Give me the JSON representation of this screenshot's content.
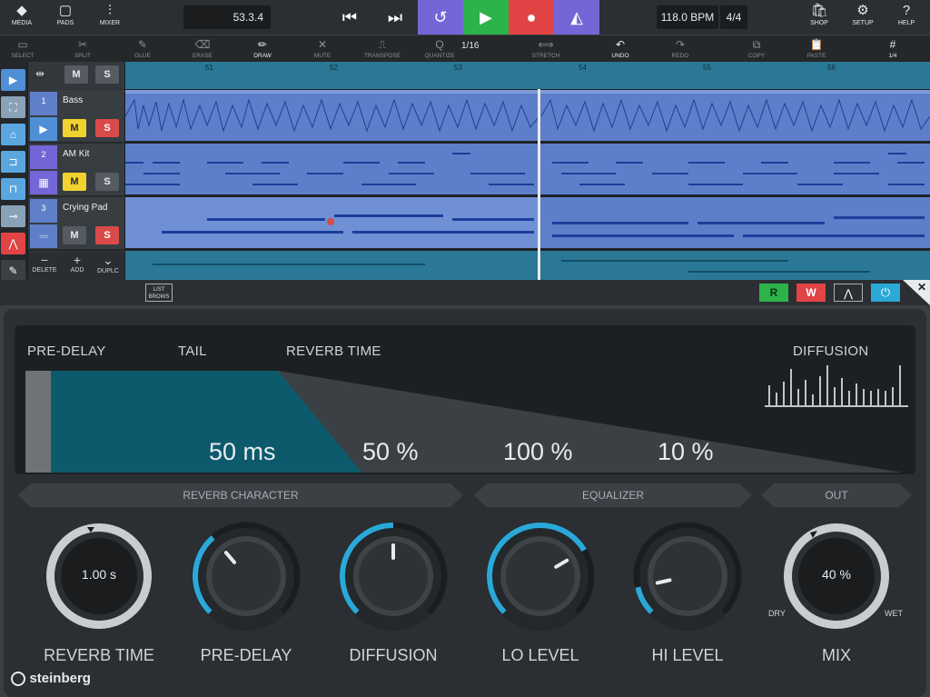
{
  "toolbar_top": {
    "media": "MEDIA",
    "pads": "PADS",
    "mixer": "MIXER",
    "position": "53.3.4",
    "tempo": "118.0 BPM",
    "signature": "4/4",
    "shop": "SHOP",
    "setup": "SETUP",
    "help": "HELP"
  },
  "tools": [
    {
      "label": "SELECT",
      "icon": "select-icon",
      "active": true
    },
    {
      "label": "SPLIT",
      "icon": "split-icon",
      "active": false
    },
    {
      "label": "GLUE",
      "icon": "glue-icon",
      "active": false
    },
    {
      "label": "ERASE",
      "icon": "erase-icon",
      "active": false
    },
    {
      "label": "DRAW",
      "icon": "draw-icon",
      "active": true
    },
    {
      "label": "MUTE",
      "icon": "mute-icon",
      "active": false
    },
    {
      "label": "TRANSPOSE",
      "icon": "transpose-icon",
      "active": false
    },
    {
      "label": "QUANTIZE",
      "icon": "quantize-icon",
      "active": false
    },
    {
      "label": "STRETCH",
      "icon": "stretch-icon",
      "active": false
    },
    {
      "label": "UNDO",
      "icon": "undo-icon",
      "active": true
    },
    {
      "label": "REDO",
      "icon": "redo-icon",
      "active": false
    },
    {
      "label": "COPY",
      "icon": "copy-icon",
      "active": false
    },
    {
      "label": "PASTE",
      "icon": "paste-icon",
      "active": false
    }
  ],
  "quantize_value": "1/16",
  "grid_value": "1/4",
  "header_row": {
    "mute": "M",
    "solo": "S"
  },
  "tracks": [
    {
      "num": "1",
      "name": "Bass",
      "mute": "M",
      "solo": "S"
    },
    {
      "num": "2",
      "name": "AM Kit",
      "mute": "M",
      "solo": "S"
    },
    {
      "num": "3",
      "name": "Crying Pad",
      "mute": "M",
      "solo": "S"
    }
  ],
  "track_actions": {
    "delete": "DELETE",
    "add": "ADD",
    "duplicate": "DUPLC"
  },
  "ruler_bars": [
    "51",
    "52",
    "53",
    "54",
    "55",
    "56"
  ],
  "panel_bar": {
    "list_browse": "LIST\nBROWS",
    "read": "R",
    "write": "W"
  },
  "display": {
    "predelay_label": "PRE-DELAY",
    "tail_label": "TAIL",
    "reverb_time_label": "REVERB TIME",
    "diffusion_label": "DIFFUSION",
    "predelay_value": "50 ms",
    "diffusion_value": "50 %",
    "lo_value": "100 %",
    "hi_value": "10 %"
  },
  "sections": {
    "character": "REVERB CHARACTER",
    "equalizer": "EQUALIZER",
    "out": "OUT"
  },
  "knobs": {
    "reverb_time": {
      "label": "REVERB TIME",
      "value": "1.00 s"
    },
    "predelay": {
      "label": "PRE-DELAY",
      "level": 0.35
    },
    "diffusion": {
      "label": "DIFFUSION",
      "level": 0.5
    },
    "lo_level": {
      "label": "LO LEVEL",
      "level": 0.72
    },
    "hi_level": {
      "label": "HI LEVEL",
      "level": 0.12
    },
    "mix": {
      "label": "MIX",
      "value": "40 %",
      "dry": "DRY",
      "wet": "WET"
    }
  },
  "brand": "steinberg",
  "colors": {
    "accent": "#2aa8d8",
    "teal_fill": "#0d5a6c",
    "record": "#e04444",
    "play": "#2cb34a",
    "loop": "#7466d6",
    "mute": "#f2d22e",
    "solo": "#d94a4a"
  }
}
